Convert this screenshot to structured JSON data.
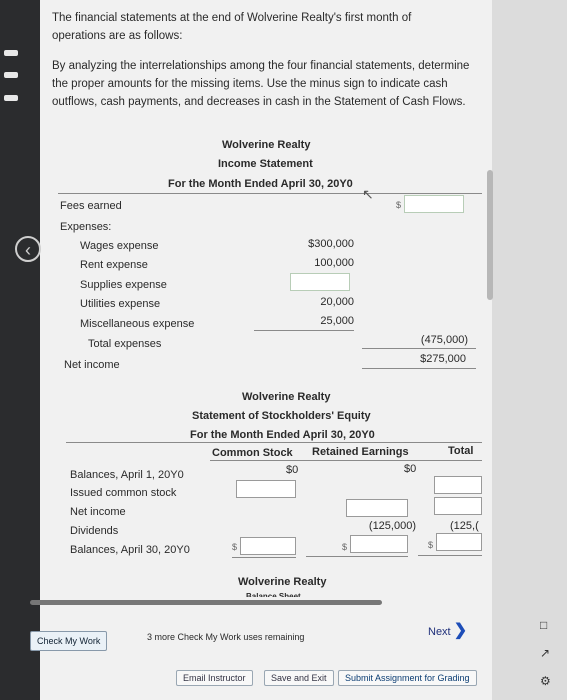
{
  "intro": {
    "line1": "The financial statements at the end of Wolverine Realty's first month of operations are as follows:",
    "line2": "By analyzing the interrelationships among the four financial statements, determine the proper amounts for the missing items. Use the minus sign to indicate cash outflows, cash payments, and decreases in cash in the Statement of Cash Flows."
  },
  "income_statement": {
    "company": "Wolverine Realty",
    "title": "Income Statement",
    "period": "For the Month Ended April 30, 20Y0",
    "fees_earned": "Fees earned",
    "expenses_label": "Expenses:",
    "rows": [
      {
        "label": "Wages expense",
        "value": "$300,000"
      },
      {
        "label": "Rent expense",
        "value": "100,000"
      },
      {
        "label": "Supplies expense",
        "value": ""
      },
      {
        "label": "Utilities expense",
        "value": "20,000"
      },
      {
        "label": "Miscellaneous expense",
        "value": "25,000"
      }
    ],
    "total_expenses_label": "Total expenses",
    "total_expenses_value": "(475,000)",
    "net_income_label": "Net income",
    "net_income_value": "$275,000",
    "dollar_sign": "$"
  },
  "equity_statement": {
    "company": "Wolverine Realty",
    "title": "Statement of Stockholders' Equity",
    "period": "For the Month Ended April 30, 20Y0",
    "col_common": "Common Stock",
    "col_retained": "Retained Earnings",
    "col_total": "Total",
    "balances_start": "Balances, April 1, 20Y0",
    "start_common": "$0",
    "start_retained": "$0",
    "issued": "Issued common stock",
    "net_income": "Net income",
    "dividends": "Dividends",
    "dividends_retained": "(125,000)",
    "dividends_total": "(125,(",
    "balances_end": "Balances, April 30, 20Y0",
    "dollar_sign": "$"
  },
  "balance_sheet": {
    "company": "Wolverine Realty",
    "title_partial": "Balance Sheet"
  },
  "footer": {
    "check_my_work": "Check My Work",
    "remaining": "3 more Check My Work uses remaining",
    "next": "Next",
    "email_instructor": "Email Instructor",
    "save_exit": "Save and Exit",
    "submit": "Submit Assignment for Grading"
  },
  "icons": [
    "back-chevron-icon",
    "cursor-icon",
    "next-chevron-icon",
    "expand-icon",
    "external-link-icon",
    "settings-icon"
  ]
}
